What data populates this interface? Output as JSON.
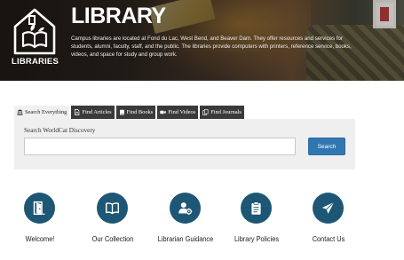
{
  "hero": {
    "logo_text": "LIBRARIES",
    "title": "LIBRARY",
    "description": "Campus libraries are located at Fond du Lac, West Bend, and Beaver Dam. They offer resources and services for students, alumni, faculty, staff, and the public. The libraries provide computers with printers, reference service, books, videos, and space for study and group work."
  },
  "search": {
    "tabs": [
      {
        "label": "Search Everything",
        "icon": "bank-icon",
        "active": true
      },
      {
        "label": "Find Articles",
        "icon": "document-icon",
        "active": false
      },
      {
        "label": "Find Books",
        "icon": "book-icon",
        "active": false
      },
      {
        "label": "Find Videos",
        "icon": "video-icon",
        "active": false
      },
      {
        "label": "Find Journals",
        "icon": "copy-icon",
        "active": false
      }
    ],
    "label": "Search WorldCat Discovery",
    "input_value": "",
    "button_label": "Search"
  },
  "quick_links": [
    {
      "label": "Welcome!",
      "icon": "door-icon"
    },
    {
      "label": "Our Collection",
      "icon": "open-book-icon"
    },
    {
      "label": "Librarian Guidance",
      "icon": "user-gear-icon"
    },
    {
      "label": "Library Policies",
      "icon": "clipboard-icon"
    },
    {
      "label": "Contact Us",
      "icon": "paper-plane-icon"
    }
  ],
  "colors": {
    "accent_circle": "#1d5775",
    "search_button": "#3276b1",
    "tab_dark": "#3a3a3a",
    "panel_bg": "#efefef"
  }
}
